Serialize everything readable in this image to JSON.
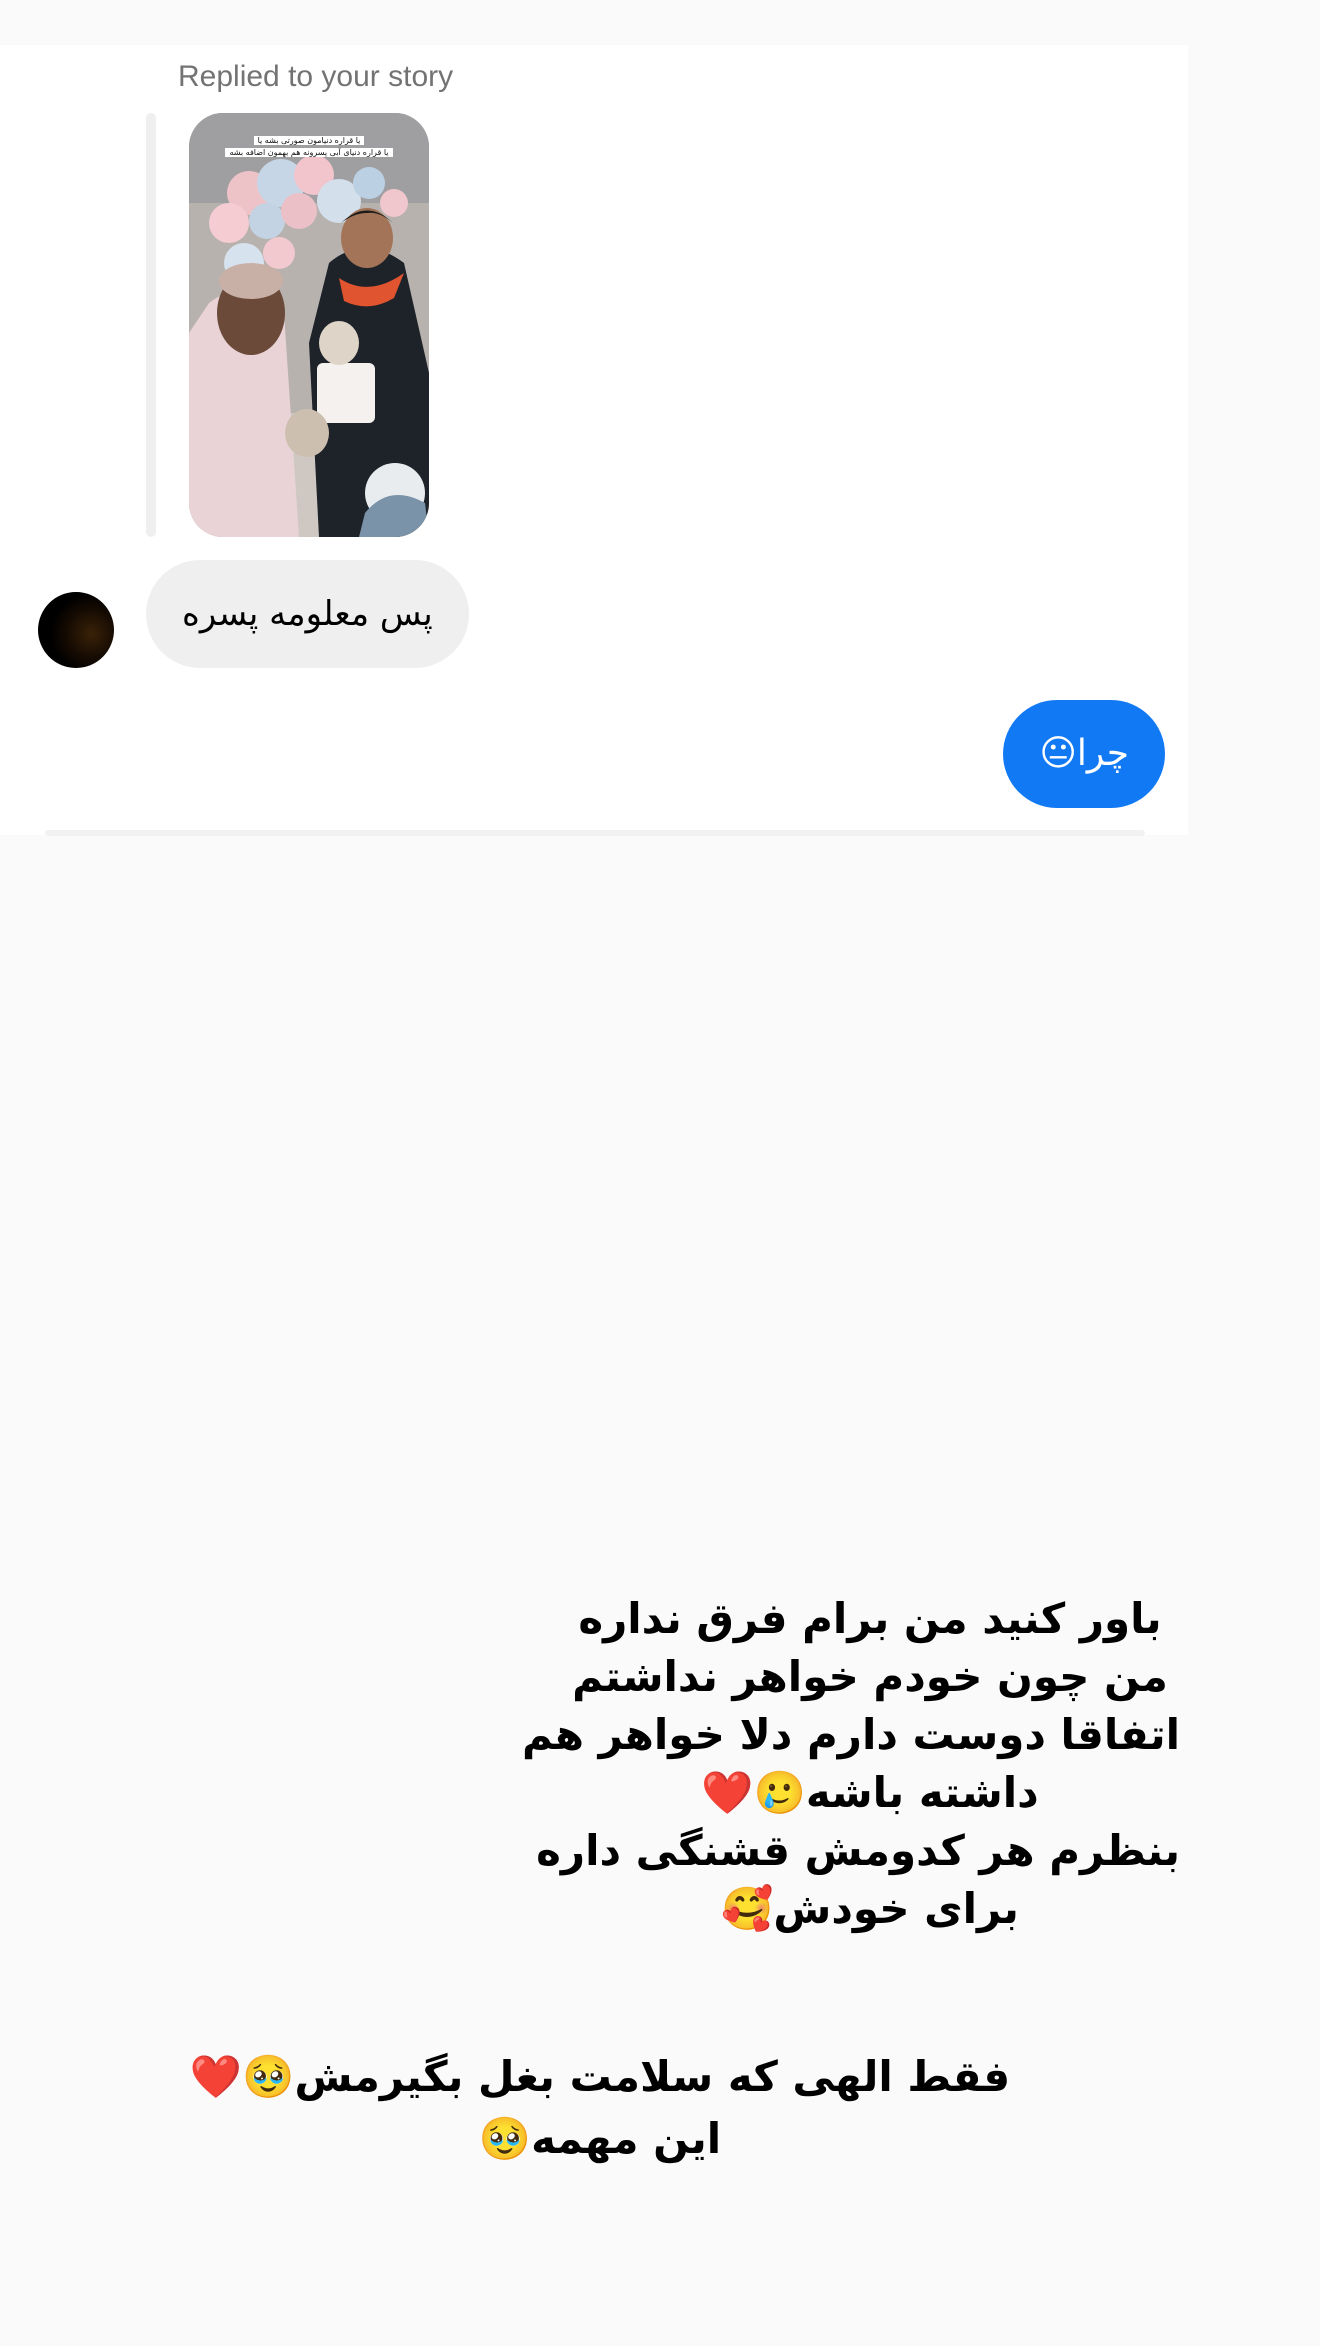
{
  "thread": {
    "reply_label": "Replied to your story",
    "story_caption_line1": "یا قراره دنیامون صورتی بشه یا",
    "story_caption_line2": "یا قراره دنیای آبی پسرونه هم بهمون اضافه بشه",
    "incoming_message": "پس معلومه پسره",
    "outgoing_message": "چرا😐"
  },
  "story_overlay": {
    "block1_lines": [
      "باور کنید من برام فرق نداره",
      "من چون خودم خواهر نداشتم",
      "اتفاقا دوست دارم دلا خواهر هم",
      "داشته باشه🥲❤️",
      "بنظرم هر کدومش قشنگی داره",
      "برای خودش🥰"
    ],
    "block2_lines": [
      "فقط الهی که سلامت بغل بگیرمش🥹❤️",
      "این مهمه🥹"
    ]
  },
  "colors": {
    "outgoing_bubble": "#1279f5",
    "incoming_bubble": "#efefef",
    "page_background": "#fafafa"
  },
  "icons": {
    "avatar": "profile-avatar"
  }
}
